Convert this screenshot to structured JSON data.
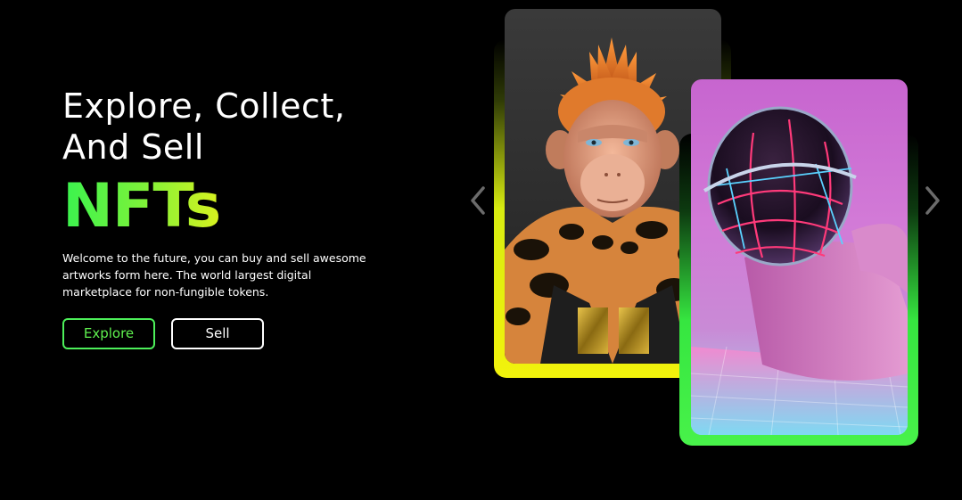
{
  "hero": {
    "headline_line1": "Explore, Collect,",
    "headline_line2": "And Sell",
    "accent_word": "NFTs",
    "description": "Welcome to the future, you can buy and sell awesome artworks form here. The world largest digital marketplace for non-fungible tokens."
  },
  "buttons": {
    "explore_label": "Explore",
    "sell_label": "Sell"
  },
  "carousel": {
    "prev_icon": "chevron-left-icon",
    "next_icon": "chevron-right-icon",
    "cards": [
      {
        "subject": "orange-haired ape in fur coat",
        "frame_color": "#f2f30c"
      },
      {
        "subject": "chrome helmet figure with neon lines",
        "frame_color": "#48f24a"
      }
    ]
  },
  "colors": {
    "background": "#000000",
    "accent_green": "#39f34f",
    "accent_yellow": "#d9f21f",
    "text": "#ffffff"
  }
}
